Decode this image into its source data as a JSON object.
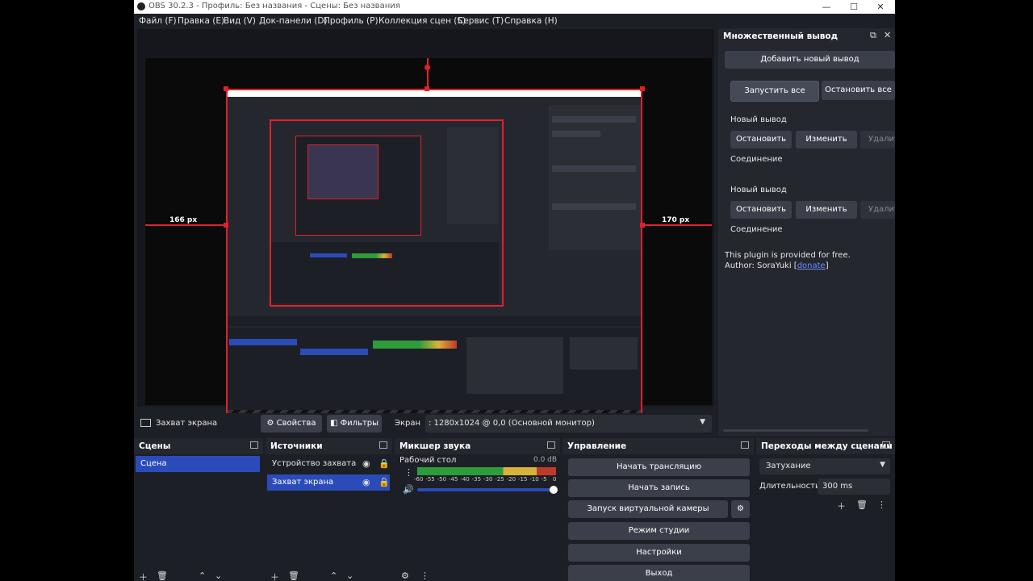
{
  "window": {
    "title": "OBS 30.2.3 - Профиль: Без названия - Сцены: Без названия",
    "minimize_label": "—",
    "maximize_label": "☐",
    "close_label": "✕"
  },
  "menu": [
    "Файл (F)",
    "Правка (E)",
    "Вид (V)",
    "Док-панели (D)",
    "Профиль (P)",
    "Коллекция сцен (S)",
    "Сервис (T)",
    "Справка (H)"
  ],
  "preview": {
    "left_dim": "166 px",
    "right_dim": "170 px",
    "nested_left": "166 px",
    "nested_right": "170 px"
  },
  "source_toolbar": {
    "source_name": "Захват экрана",
    "properties_label": "Свойства",
    "filters_label": "Фильтры",
    "screen_label": "Экран",
    "screen_value": ": 1280x1024 @ 0,0 (Основной монитор)"
  },
  "multi_output": {
    "title": "Множественный вывод",
    "add_label": "Добавить новый вывод",
    "start_all": "Запустить все",
    "stop_all": "Остановить все",
    "outputs": [
      {
        "name": "Новый вывод",
        "stop": "Остановить",
        "edit": "Изменить",
        "delete": "Удалить",
        "conn": "Соединение"
      },
      {
        "name": "Новый вывод",
        "stop": "Остановить",
        "edit": "Изменить",
        "delete": "Удалить",
        "conn": "Соединение"
      }
    ],
    "free_note": "This plugin is provided for free.",
    "author_prefix": "Author: SoraYuki [",
    "donate": "donate",
    "author_suffix": "]"
  },
  "scenes": {
    "title": "Сцены",
    "items": [
      "Сцена"
    ]
  },
  "sources": {
    "title": "Источники",
    "items": [
      "Устройство захвата в",
      "Захват экрана"
    ]
  },
  "mixer": {
    "title": "Микшер звука",
    "channel": "Рабочий стол",
    "db": "0.0 dB",
    "ticks": [
      "-60",
      "-55",
      "-50",
      "-45",
      "-40",
      "-35",
      "-30",
      "-25",
      "-20",
      "-15",
      "-10",
      "-5",
      "0"
    ]
  },
  "controls": {
    "title": "Управление",
    "buttons": [
      "Начать трансляцию",
      "Начать запись",
      "Запуск виртуальной камеры",
      "Режим студии",
      "Настройки",
      "Выход"
    ]
  },
  "transitions": {
    "title": "Переходы между сценами",
    "selected": "Затухание",
    "duration_label": "Длительность",
    "duration_value": "300 ms"
  },
  "colors": {
    "accent": "#e3202a",
    "selection": "#2b4bb8",
    "panel": "#1d1f26"
  }
}
